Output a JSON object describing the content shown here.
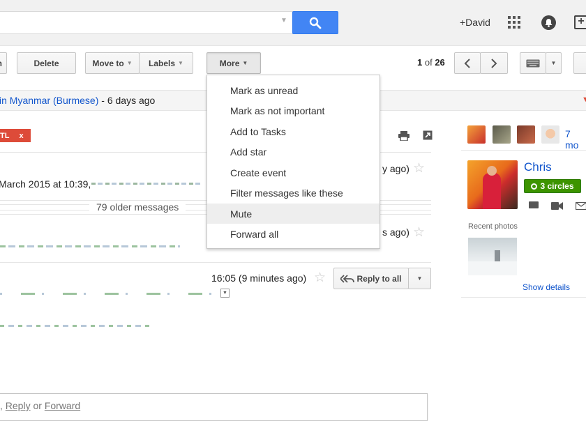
{
  "header": {
    "user_label": "+David"
  },
  "toolbar": {
    "partial_label": "n",
    "delete_label": "Delete",
    "move_to_label": "Move to",
    "labels_label": "Labels",
    "more_label": "More",
    "pager_current": "1",
    "pager_of": "of",
    "pager_total": "26"
  },
  "translation_bar": {
    "language_link": "in Myanmar (Burmese)",
    "suffix": " - 6 days ago"
  },
  "label_chip": {
    "text": "TL",
    "close": "x"
  },
  "messages": {
    "msg1_date": "March 2015 at 10:39,",
    "msg1_time_fragment": "y ago)",
    "older_messages": "79 older messages",
    "msg2_time_fragment": "s ago)",
    "msg3_time": "16:05 (9 minutes ago)",
    "reply_all_label": "Reply to all"
  },
  "more_menu": {
    "items": [
      "Mark as unread",
      "Mark as not important",
      "Add to Tasks",
      "Add star",
      "Create event",
      "Filter messages like these",
      "Mute",
      "Forward all"
    ],
    "highlighted": "Mute"
  },
  "right_panel": {
    "more_people": "7 mo",
    "contact_name": "Chris",
    "circles_label": "3 circles",
    "recent_photos_label": "Recent photos",
    "show_details_label": "Show details"
  },
  "reply_box": {
    "prefix": ", ",
    "reply_link": "Reply",
    "or_text": " or ",
    "forward_link": "Forward"
  },
  "colors": {
    "accent_blue": "#4285f4",
    "link_blue": "#1155cc",
    "label_red": "#dd4b39",
    "circles_green": "#3d9400"
  }
}
